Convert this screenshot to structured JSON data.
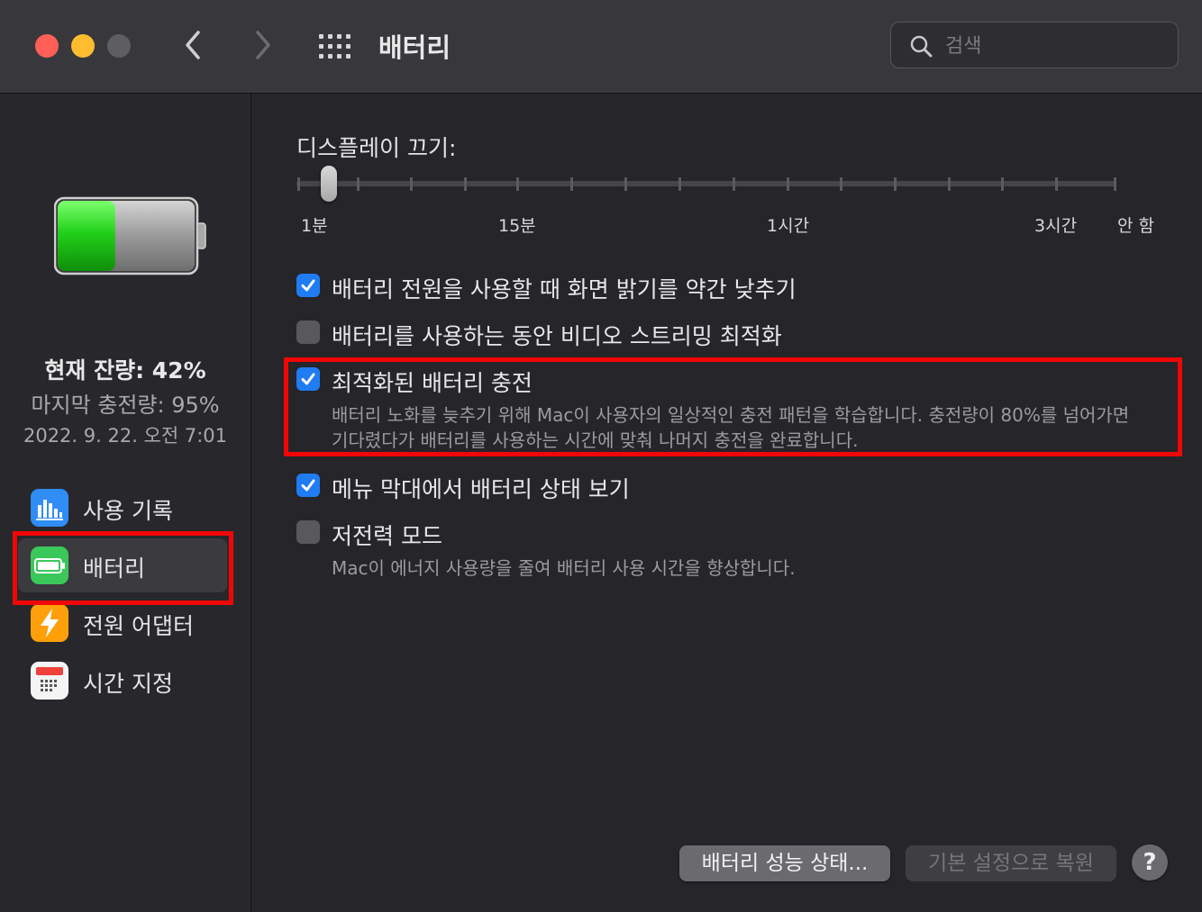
{
  "window": {
    "title": "배터리"
  },
  "search": {
    "placeholder": "검색",
    "value": ""
  },
  "sidebar": {
    "status": {
      "current": "현재 잔량: 42%",
      "last_charge": "마지막 충전량: 95%",
      "date": "2022. 9. 22. 오전 7:01"
    },
    "battery_level": 0.42,
    "items": [
      {
        "label": "사용 기록",
        "icon": "usage-chart-icon"
      },
      {
        "label": "배터리",
        "icon": "battery-icon",
        "selected": true
      },
      {
        "label": "전원 어댑터",
        "icon": "lightning-icon"
      },
      {
        "label": "시간 지정",
        "icon": "calendar-icon"
      }
    ]
  },
  "display_off": {
    "label": "디스플레이 끄기:",
    "tick_labels": [
      "1분",
      "15분",
      "1시간",
      "3시간",
      "안 함"
    ]
  },
  "options": [
    {
      "label": "배터리 전원을 사용할 때 화면 밝기를 약간 낮추기",
      "checked": true
    },
    {
      "label": "배터리를 사용하는 동안 비디오 스트리밍 최적화",
      "checked": false
    },
    {
      "label": "최적화된 배터리 충전",
      "checked": true,
      "desc_line1": "배터리 노화를 늦추기 위해 Mac이 사용자의 일상적인 충전 패턴을 학습합니다. 충전량이 80%를 넘어가면",
      "desc_line2": "기다렸다가 배터리를 사용하는 시간에 맞춰 나머지 충전을 완료합니다."
    },
    {
      "label": "메뉴 막대에서 배터리 상태 보기",
      "checked": true
    },
    {
      "label": "저전력 모드",
      "checked": false,
      "desc_line1": "Mac이 에너지 사용량을 줄여 배터리 사용 시간을 향상합니다."
    }
  ],
  "buttons": {
    "health": "배터리 성능 상태...",
    "restore": "기본 설정으로 복원",
    "help": "?"
  },
  "colors": {
    "accent": "#1f7cf3",
    "highlight": "#f10606",
    "battery_green": "#22d11a"
  }
}
